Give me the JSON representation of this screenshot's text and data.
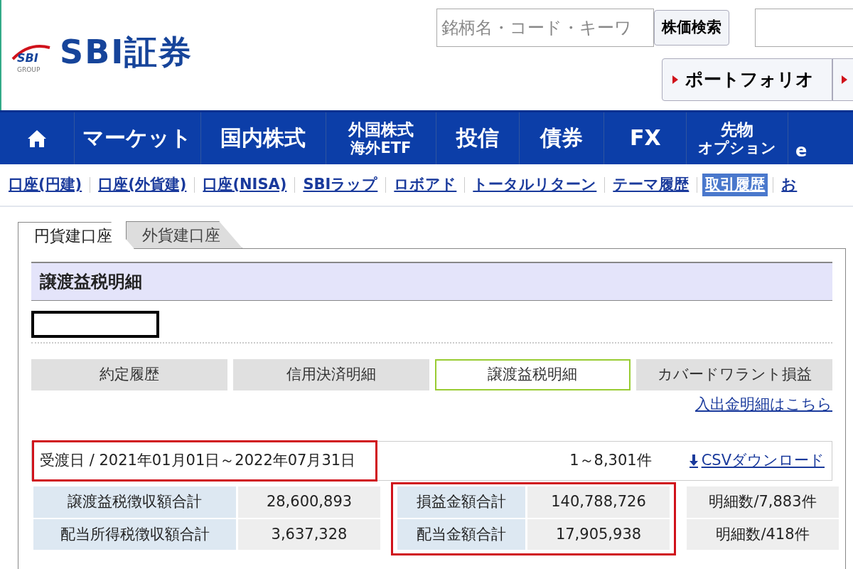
{
  "header": {
    "logo_badge": "SBI",
    "logo_group": "GROUP",
    "logo_text": "SBI証券",
    "search": {
      "placeholder": "銘柄名・コード・キーワ"
    },
    "search_button": "株価検索",
    "portfolio_button": "ポートフォリオ"
  },
  "main_nav": [
    {
      "kind": "home"
    },
    {
      "kind": "text",
      "lines": [
        "マーケット"
      ]
    },
    {
      "kind": "text",
      "lines": [
        "国内株式"
      ]
    },
    {
      "kind": "text",
      "lines": [
        "外国株式",
        "海外ETF"
      ]
    },
    {
      "kind": "text",
      "lines": [
        "投信"
      ]
    },
    {
      "kind": "text",
      "lines": [
        "債券"
      ]
    },
    {
      "kind": "text",
      "lines": [
        "FX"
      ]
    },
    {
      "kind": "text",
      "lines": [
        "先物",
        "オプション"
      ]
    },
    {
      "kind": "text",
      "lines": [
        "e"
      ]
    }
  ],
  "sub_nav": [
    {
      "label": "口座(円建)",
      "selected": false
    },
    {
      "label": "口座(外貨建)",
      "selected": false
    },
    {
      "label": "口座(NISA)",
      "selected": false
    },
    {
      "label": "SBIラップ",
      "selected": false
    },
    {
      "label": "ロボアド",
      "selected": false
    },
    {
      "label": "トータルリターン",
      "selected": false
    },
    {
      "label": "テーマ履歴",
      "selected": false
    },
    {
      "label": "取引履歴",
      "selected": true
    },
    {
      "label": "お",
      "selected": false
    }
  ],
  "account_tabs": [
    {
      "label": "円貨建口座",
      "selected": true
    },
    {
      "label": "外貨建口座",
      "selected": false
    }
  ],
  "section_title": "譲渡益税明細",
  "redacted": true,
  "report_tabs": [
    {
      "label": "約定履歴",
      "selected": false
    },
    {
      "label": "信用決済明細",
      "selected": false
    },
    {
      "label": "譲渡益税明細",
      "selected": true
    },
    {
      "label": "カバードワラント損益",
      "selected": false
    }
  ],
  "deposit_link": "入出金明細はこちら",
  "summary": {
    "date_range": "受渡日 / 2021年01月01日～2022年07月31日",
    "date_highlighted": true,
    "count": "1～8,301件",
    "csv_link": "CSVダウンロード"
  },
  "totals": {
    "groups": [
      {
        "highlighted": false,
        "rows": [
          [
            "譲渡益税徴収額合計",
            "28,600,893"
          ],
          [
            "配当所得税徴収額合計",
            "3,637,328"
          ]
        ]
      },
      {
        "highlighted": true,
        "rows": [
          [
            "損益金額合計",
            "140,788,726"
          ],
          [
            "配当金額合計",
            "17,905,938"
          ]
        ]
      },
      {
        "highlighted": false,
        "rows": [
          [
            "明細数/7,883件"
          ],
          [
            "明細数/418件"
          ]
        ]
      }
    ]
  }
}
